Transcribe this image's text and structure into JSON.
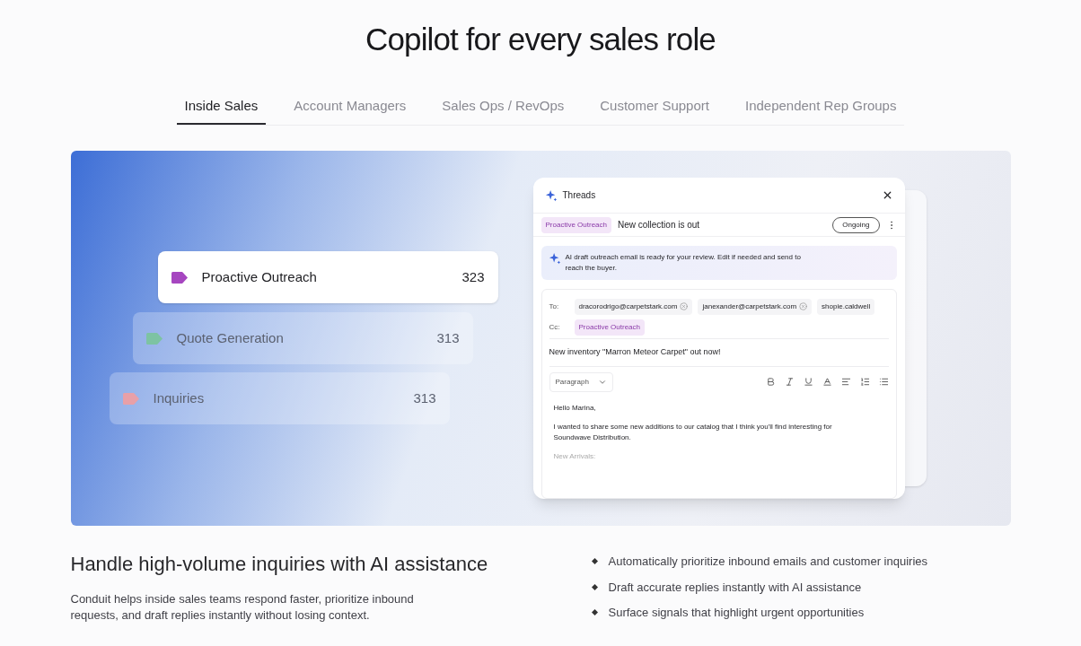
{
  "title": "Copilot for every sales role",
  "tabs": [
    {
      "label": "Inside Sales",
      "selected": true
    },
    {
      "label": "Account Managers",
      "selected": false
    },
    {
      "label": "Sales Ops / RevOps",
      "selected": false
    },
    {
      "label": "Customer Support",
      "selected": false
    },
    {
      "label": "Independent Rep Groups",
      "selected": false
    }
  ],
  "categories": [
    {
      "name": "Proactive Outreach",
      "count": "323",
      "color": "#a646c0",
      "selected": true
    },
    {
      "name": "Quote Generation",
      "count": "313",
      "color": "#7dc3a3",
      "selected": false
    },
    {
      "name": "Inquiries",
      "count": "313",
      "color": "#e8a0a8",
      "selected": false
    }
  ],
  "thread_panel": {
    "title": "Threads",
    "tag": "Proactive Outreach",
    "subject": "New collection is out",
    "status": "Ongoing",
    "ai_notice": "AI draft outreach email is ready for your review. Edit if needed and send to reach the buyer.",
    "to_label": "To:",
    "recipients": [
      "dracorodrigo@carpetstark.com",
      "janexander@carpetstark.com",
      "shopie.caldwell"
    ],
    "cc_label": "Cc:",
    "cc": [
      "Proactive Outreach"
    ],
    "email_subject": "New inventory \"Marron Meteor Carpet\" out now!",
    "format": "Paragraph",
    "body": [
      "Hello Marina,",
      "I wanted to share some new additions to our catalog that I think you'll find interesting for Soundwave Distribution."
    ],
    "section_heading": "New Arrivals:"
  },
  "heading": "Handle high-volume inquiries with AI assistance",
  "description": "Conduit helps inside sales teams respond faster, prioritize inbound requests, and draft replies instantly without losing context.",
  "bullets": [
    "Automatically prioritize inbound emails and customer inquiries",
    "Draft accurate replies instantly with AI assistance",
    "Surface signals that highlight urgent opportunities"
  ]
}
